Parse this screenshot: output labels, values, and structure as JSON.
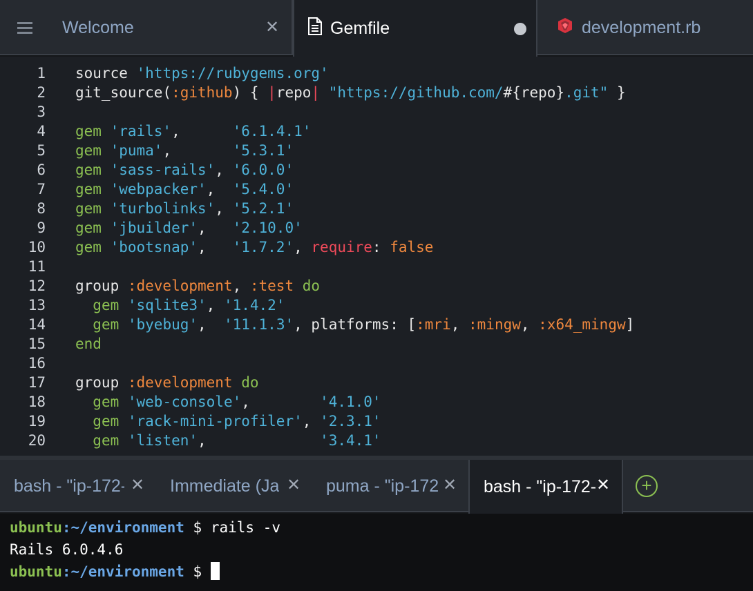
{
  "editor_tabs": [
    {
      "label": "Welcome",
      "state": "closable"
    },
    {
      "label": "Gemfile",
      "state": "modified"
    },
    {
      "label": "development.rb",
      "state": "inactive"
    }
  ],
  "colors": {
    "string": "#4fb3d9",
    "symbol": "#f0883e",
    "keyword_green": "#8cc152",
    "accent_red": "#ef4a5a",
    "tab_text": "#8fa6c4",
    "editor_bg": "#1c1f24"
  },
  "icons": {
    "menu": "hamburger-icon",
    "gemfile": "document-icon",
    "development": "ruby-gem-icon",
    "close": "close-icon",
    "modified": "unsaved-dot-icon",
    "add": "plus-circle-icon"
  },
  "editor": {
    "lines": [
      {
        "n": "1",
        "tokens": [
          [
            "kw",
            "source "
          ],
          [
            "str",
            "'https://rubygems.org'"
          ]
        ]
      },
      {
        "n": "2",
        "tokens": [
          [
            "kw",
            "git_source("
          ],
          [
            "sym",
            ":github"
          ],
          [
            "kw",
            ") { "
          ],
          [
            "pipe",
            "|"
          ],
          [
            "kw",
            "repo"
          ],
          [
            "pipe",
            "|"
          ],
          [
            "kw",
            " "
          ],
          [
            "str",
            "\"https://github.com/"
          ],
          [
            "kw",
            "#{repo}"
          ],
          [
            "str",
            ".git\""
          ],
          [
            "kw",
            " }"
          ]
        ]
      },
      {
        "n": "3",
        "tokens": []
      },
      {
        "n": "4",
        "tokens": [
          [
            "gem",
            "gem "
          ],
          [
            "str",
            "'rails'"
          ],
          [
            "kw",
            ",      "
          ],
          [
            "str",
            "'6.1.4.1'"
          ]
        ]
      },
      {
        "n": "5",
        "tokens": [
          [
            "gem",
            "gem "
          ],
          [
            "str",
            "'puma'"
          ],
          [
            "kw",
            ",       "
          ],
          [
            "str",
            "'5.3.1'"
          ]
        ]
      },
      {
        "n": "6",
        "tokens": [
          [
            "gem",
            "gem "
          ],
          [
            "str",
            "'sass-rails'"
          ],
          [
            "kw",
            ", "
          ],
          [
            "str",
            "'6.0.0'"
          ]
        ]
      },
      {
        "n": "7",
        "tokens": [
          [
            "gem",
            "gem "
          ],
          [
            "str",
            "'webpacker'"
          ],
          [
            "kw",
            ",  "
          ],
          [
            "str",
            "'5.4.0'"
          ]
        ]
      },
      {
        "n": "8",
        "tokens": [
          [
            "gem",
            "gem "
          ],
          [
            "str",
            "'turbolinks'"
          ],
          [
            "kw",
            ", "
          ],
          [
            "str",
            "'5.2.1'"
          ]
        ]
      },
      {
        "n": "9",
        "tokens": [
          [
            "gem",
            "gem "
          ],
          [
            "str",
            "'jbuilder'"
          ],
          [
            "kw",
            ",   "
          ],
          [
            "str",
            "'2.10.0'"
          ]
        ]
      },
      {
        "n": "10",
        "tokens": [
          [
            "gem",
            "gem "
          ],
          [
            "str",
            "'bootsnap'"
          ],
          [
            "kw",
            ",   "
          ],
          [
            "str",
            "'1.7.2'"
          ],
          [
            "kw",
            ", "
          ],
          [
            "red",
            "require"
          ],
          [
            "kw",
            ": "
          ],
          [
            "sym",
            "false"
          ]
        ]
      },
      {
        "n": "11",
        "tokens": []
      },
      {
        "n": "12",
        "tokens": [
          [
            "kw",
            "group "
          ],
          [
            "sym",
            ":development"
          ],
          [
            "kw",
            ", "
          ],
          [
            "sym",
            ":test"
          ],
          [
            "kw",
            " "
          ],
          [
            "do",
            "do"
          ]
        ]
      },
      {
        "n": "13",
        "tokens": [
          [
            "kw",
            "  "
          ],
          [
            "gem",
            "gem "
          ],
          [
            "str",
            "'sqlite3'"
          ],
          [
            "kw",
            ", "
          ],
          [
            "str",
            "'1.4.2'"
          ]
        ]
      },
      {
        "n": "14",
        "tokens": [
          [
            "kw",
            "  "
          ],
          [
            "gem",
            "gem "
          ],
          [
            "str",
            "'byebug'"
          ],
          [
            "kw",
            ",  "
          ],
          [
            "str",
            "'11.1.3'"
          ],
          [
            "kw",
            ", platforms: ["
          ],
          [
            "sym",
            ":mri"
          ],
          [
            "kw",
            ", "
          ],
          [
            "sym",
            ":mingw"
          ],
          [
            "kw",
            ", "
          ],
          [
            "sym",
            ":x64_mingw"
          ],
          [
            "kw",
            "]"
          ]
        ]
      },
      {
        "n": "15",
        "tokens": [
          [
            "do",
            "end"
          ]
        ]
      },
      {
        "n": "16",
        "tokens": []
      },
      {
        "n": "17",
        "tokens": [
          [
            "kw",
            "group "
          ],
          [
            "sym",
            ":development"
          ],
          [
            "kw",
            " "
          ],
          [
            "do",
            "do"
          ]
        ]
      },
      {
        "n": "18",
        "tokens": [
          [
            "kw",
            "  "
          ],
          [
            "gem",
            "gem "
          ],
          [
            "str",
            "'web-console'"
          ],
          [
            "kw",
            ",        "
          ],
          [
            "str",
            "'4.1.0'"
          ]
        ]
      },
      {
        "n": "19",
        "tokens": [
          [
            "kw",
            "  "
          ],
          [
            "gem",
            "gem "
          ],
          [
            "str",
            "'rack-mini-profiler'"
          ],
          [
            "kw",
            ", "
          ],
          [
            "str",
            "'2.3.1'"
          ]
        ]
      },
      {
        "n": "20",
        "tokens": [
          [
            "kw",
            "  "
          ],
          [
            "gem",
            "gem "
          ],
          [
            "str",
            "'listen'"
          ],
          [
            "kw",
            ",             "
          ],
          [
            "str",
            "'3.4.1'"
          ]
        ]
      }
    ]
  },
  "terminal_tabs": [
    {
      "label": "bash - \"ip-172-",
      "active": false
    },
    {
      "label": "Immediate (Ja",
      "active": false
    },
    {
      "label": "puma - \"ip-172",
      "active": false
    },
    {
      "label": "bash - \"ip-172-",
      "active": true
    }
  ],
  "terminal": {
    "user": "ubuntu",
    "path": ":~/environment",
    "prompt": " $ ",
    "command": "rails -v",
    "output": "Rails 6.0.4.6"
  }
}
